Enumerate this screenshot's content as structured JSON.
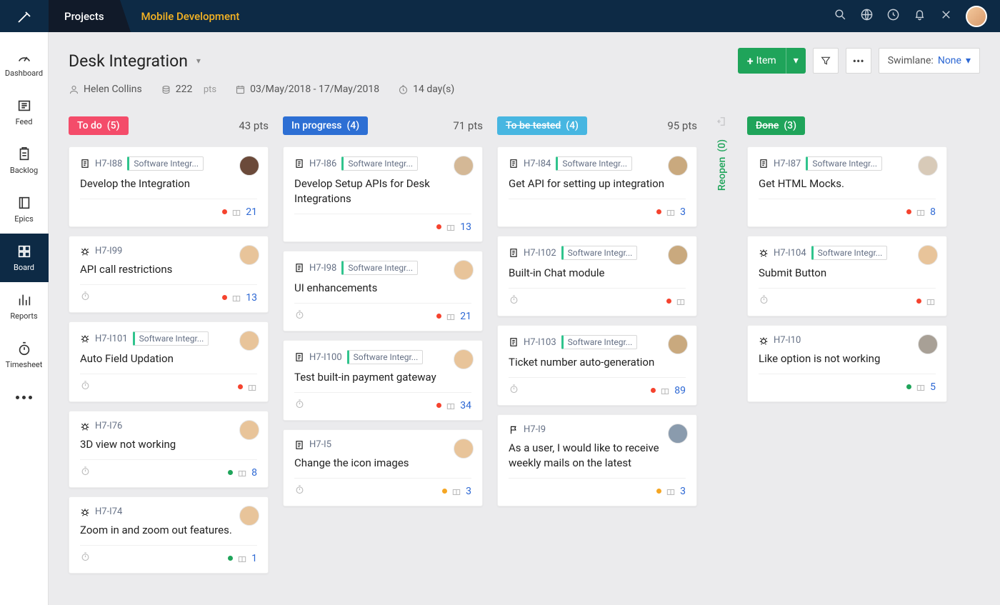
{
  "nav": {
    "projects": "Projects",
    "mobile": "Mobile Development"
  },
  "sidebar": [
    {
      "label": "Dashboard",
      "icon": "gauge"
    },
    {
      "label": "Feed",
      "icon": "news"
    },
    {
      "label": "Backlog",
      "icon": "clipboard"
    },
    {
      "label": "Epics",
      "icon": "book"
    },
    {
      "label": "Board",
      "icon": "grid",
      "active": true
    },
    {
      "label": "Reports",
      "icon": "bars"
    },
    {
      "label": "Timesheet",
      "icon": "stopwatch"
    }
  ],
  "page": {
    "title": "Desk Integration",
    "owner": "Helen Collins",
    "points": "222",
    "points_suffix": "pts",
    "dates": "03/May/2018  -  17/May/2018",
    "duration": "14 day(s)"
  },
  "actions": {
    "item": "Item",
    "swimlane_label": "Swimlane:",
    "swimlane_value": "None"
  },
  "columns": [
    {
      "key": "todo",
      "label": "To do",
      "count": "(5)",
      "pts": "43 pts",
      "cls": "todo"
    },
    {
      "key": "progress",
      "label": "In progress",
      "count": "(4)",
      "pts": "71 pts",
      "cls": "progress"
    },
    {
      "key": "tested",
      "label": "To be tested",
      "count": "(4)",
      "pts": "95 pts",
      "cls": "tested",
      "strike": true
    },
    {
      "key": "done",
      "label": "Done",
      "count": "(3)",
      "pts": "",
      "cls": "done",
      "strike": true
    }
  ],
  "reopen": {
    "label": "Reopen",
    "count": "(0)"
  },
  "cards": {
    "todo": [
      {
        "id": "H7-I88",
        "type": "doc",
        "tag": "Software Integr...",
        "title": "Develop the Integration",
        "avatar": "a1",
        "num": "21",
        "dot": "red",
        "clock": false
      },
      {
        "id": "H7-I99",
        "type": "bug",
        "title": "API call restrictions",
        "avatar": "a2",
        "num": "13",
        "dot": "red",
        "clock": true
      },
      {
        "id": "H7-I101",
        "type": "bug",
        "tag": "Software Integr...",
        "title": "Auto Field Updation",
        "avatar": "a2",
        "dot": "red",
        "clock": true,
        "docic": true
      },
      {
        "id": "H7-I76",
        "type": "bug",
        "title": "3D view not working",
        "avatar": "a2",
        "num": "8",
        "dot": "green",
        "clock": true
      },
      {
        "id": "H7-I74",
        "type": "bug",
        "title": "Zoom in and zoom out features.",
        "avatar": "a2",
        "num": "1",
        "dot": "green",
        "clock": true
      }
    ],
    "progress": [
      {
        "id": "H7-I86",
        "type": "doc",
        "tag": "Software Integr...",
        "title": "Develop Setup APIs for Desk Integrations",
        "avatar": "a3",
        "num": "13",
        "dot": "red",
        "clock": false
      },
      {
        "id": "H7-I98",
        "type": "doc",
        "tag": "Software Integr...",
        "title": "UI enhancements",
        "avatar": "a4",
        "num": "21",
        "dot": "red",
        "clock": true
      },
      {
        "id": "H7-I100",
        "type": "doc",
        "tag": "Software Integr...",
        "title": "Test built-in payment gateway",
        "avatar": "a4",
        "num": "34",
        "dot": "red",
        "clock": true
      },
      {
        "id": "H7-I5",
        "type": "doc",
        "title": "Change the icon images",
        "avatar": "a4",
        "num": "3",
        "dot": "orange",
        "clock": true
      }
    ],
    "tested": [
      {
        "id": "H7-I84",
        "type": "doc",
        "tag": "Software Integr...",
        "title": "Get API for setting up integration",
        "avatar": "a5",
        "num": "3",
        "dot": "red",
        "clock": false
      },
      {
        "id": "H7-I102",
        "type": "doc",
        "tag": "Software Integr...",
        "title": "Built-in Chat module",
        "avatar": "a5",
        "dot": "red",
        "clock": true,
        "docic": true
      },
      {
        "id": "H7-I103",
        "type": "doc",
        "tag": "Software Integr...",
        "title": "Ticket number auto-generation",
        "avatar": "a5",
        "num": "89",
        "dot": "red",
        "clock": true
      },
      {
        "id": "H7-I9",
        "type": "flag",
        "title": "As a user, I would like to receive weekly mails on the latest",
        "avatar": "a6",
        "num": "3",
        "dot": "orange",
        "clock": false
      }
    ],
    "done": [
      {
        "id": "H7-I87",
        "type": "doc",
        "tag": "Software Integr...",
        "title": "Get HTML Mocks.",
        "avatar": "a7",
        "num": "8",
        "dot": "red",
        "clock": false
      },
      {
        "id": "H7-I104",
        "type": "bug",
        "tag": "Software Integr...",
        "title": "Submit Button",
        "avatar": "a8",
        "dot": "red",
        "clock": true,
        "docic": true
      },
      {
        "id": "H7-I10",
        "type": "bug",
        "title": "Like option is not working",
        "avatar": "a9",
        "num": "5",
        "dot": "green",
        "clock": false
      }
    ]
  }
}
